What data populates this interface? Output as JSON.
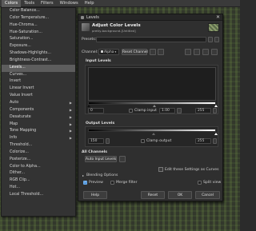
{
  "menubar": {
    "items": [
      "Colors",
      "Tools",
      "Filters",
      "Windows",
      "Help"
    ],
    "active": "Colors"
  },
  "colors_menu": {
    "items": [
      {
        "label": "Color Balance...",
        "submenu": false
      },
      {
        "label": "Color Temperature...",
        "submenu": false
      },
      {
        "label": "Hue-Chroma...",
        "submenu": false
      },
      {
        "label": "Hue-Saturation...",
        "submenu": false
      },
      {
        "label": "Saturation...",
        "submenu": false
      },
      {
        "label": "Exposure...",
        "submenu": false
      },
      {
        "label": "Shadows-Highlights...",
        "submenu": false
      },
      {
        "label": "Brightness-Contrast...",
        "submenu": false
      },
      {
        "label": "Levels...",
        "submenu": false,
        "highlighted": true
      },
      {
        "label": "Curves...",
        "submenu": false
      },
      {
        "label": "Invert",
        "submenu": false
      },
      {
        "label": "Linear Invert",
        "submenu": false
      },
      {
        "label": "Value Invert",
        "submenu": false
      },
      {
        "label": "Auto",
        "submenu": true
      },
      {
        "label": "Components",
        "submenu": true
      },
      {
        "label": "Desaturate",
        "submenu": true
      },
      {
        "label": "Map",
        "submenu": true
      },
      {
        "label": "Tone Mapping",
        "submenu": true
      },
      {
        "label": "Info",
        "submenu": true
      },
      {
        "label": "Threshold...",
        "submenu": false
      },
      {
        "label": "Colorize...",
        "submenu": false
      },
      {
        "label": "Posterize...",
        "submenu": false
      },
      {
        "label": "Color to Alpha...",
        "submenu": false
      },
      {
        "label": "Dither...",
        "submenu": false
      },
      {
        "label": "RGB Clip...",
        "submenu": false
      },
      {
        "label": "Hot...",
        "submenu": false
      },
      {
        "label": "Local Threshold...",
        "submenu": false
      }
    ]
  },
  "dialog": {
    "window_title": "Levels",
    "header_title": "Adjust Color Levels",
    "header_subtitle": "pretty-background-[Untitled]",
    "presets_label": "Presets:",
    "channel_label": "Channel:",
    "channel_value": "Alpha",
    "reset_channel": "Reset Channel",
    "input_levels_label": "Input Levels",
    "input_low": "0",
    "clamp_input_label": "Clamp input",
    "gamma": "1.00",
    "input_high": "255",
    "output_levels_label": "Output Levels",
    "output_low": "150",
    "clamp_output_label": "Clamp output",
    "output_high": "255",
    "all_channels_label": "All Channels",
    "auto_input_levels": "Auto Input Levels",
    "edit_as_curves": "Edit these Settings as Curves",
    "blending_options": "Blending Options",
    "preview_label": "Preview",
    "merge_filter_label": "Merge filter",
    "split_view_label": "Split view",
    "help_button": "Help",
    "reset_button": "Reset",
    "ok_button": "OK",
    "cancel_button": "Cancel",
    "preview_checked": true,
    "merge_filter_checked": false,
    "split_view_checked": false,
    "clamp_input_checked": false,
    "clamp_output_checked": false
  },
  "colors": {
    "accent": "#4a90d9",
    "highlight": "#5d5d5d",
    "dialog_bg": "#2f2f2f"
  }
}
